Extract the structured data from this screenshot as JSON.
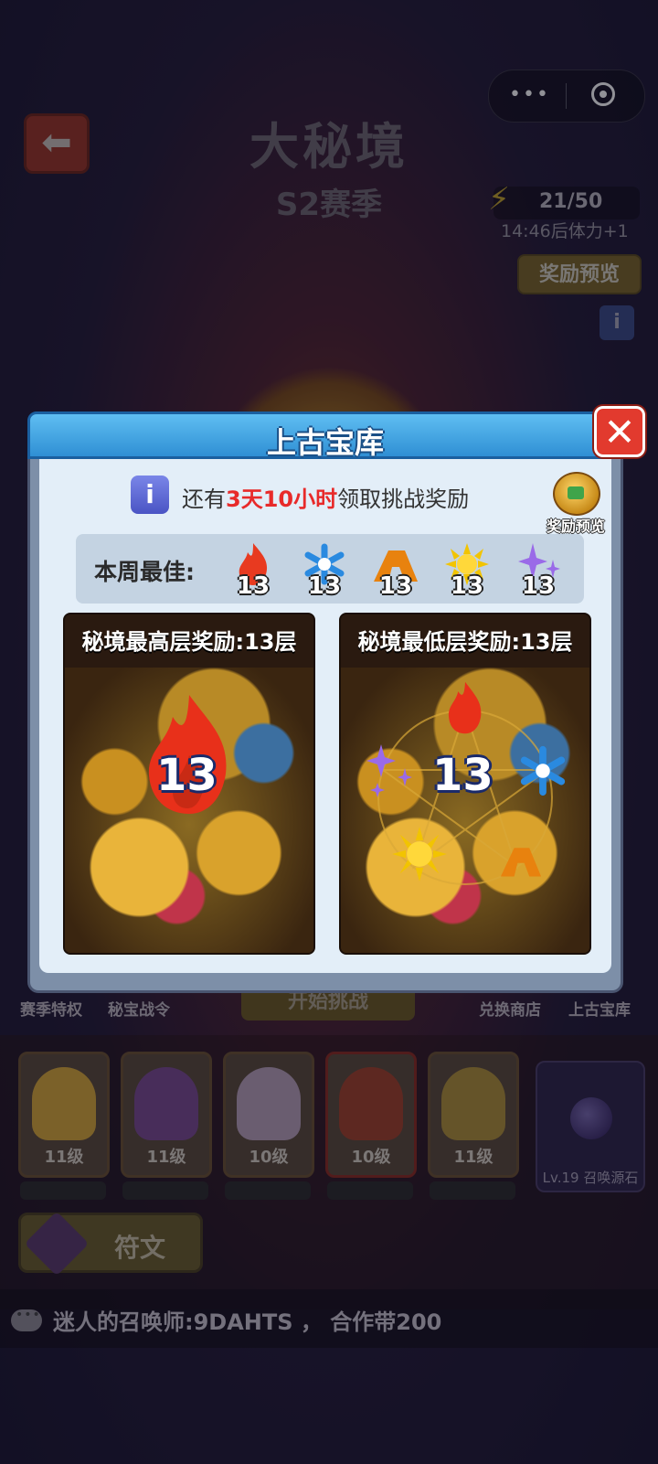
{
  "header": {
    "title": "大秘境",
    "subtitle": "S2赛季",
    "energy": "21/50",
    "energy_timer": "14:46后体力+1",
    "reward_preview": "奖励预览"
  },
  "capsule": {
    "more": "•••"
  },
  "modal": {
    "title": "上古宝库",
    "close": "✕",
    "info_prefix": "还有",
    "info_highlight": "3天10小时",
    "info_suffix": "领取挑战奖励",
    "reward_preview_label": "奖励预览",
    "best_label": "本周最佳:",
    "best": [
      {
        "icon": "fire-icon",
        "value": "13"
      },
      {
        "icon": "ice-icon",
        "value": "13"
      },
      {
        "icon": "earth-icon",
        "value": "13"
      },
      {
        "icon": "sun-icon",
        "value": "13"
      },
      {
        "icon": "sparkle-icon",
        "value": "13"
      }
    ],
    "card_high": {
      "title": "秘境最高层奖励:13层",
      "value": "13"
    },
    "card_low": {
      "title": "秘境最低层奖励:13层",
      "value": "13"
    }
  },
  "bottom": {
    "labels": [
      "赛季特权",
      "秘宝战令",
      "兑换商店",
      "上古宝库"
    ],
    "start": "开始挑战",
    "heroes": [
      {
        "level": "11级",
        "color": "#e0b040"
      },
      {
        "level": "11级",
        "color": "#8a5aa0"
      },
      {
        "level": "10级",
        "color": "#c8b0c8"
      },
      {
        "level": "10级",
        "color": "#b05030"
      },
      {
        "level": "11级",
        "color": "#c0a040"
      }
    ],
    "source_stone": "Lv.19 召唤源石",
    "rune": "符文",
    "chat": "迷人的召唤师:9DAHTS ， 合作带200"
  }
}
